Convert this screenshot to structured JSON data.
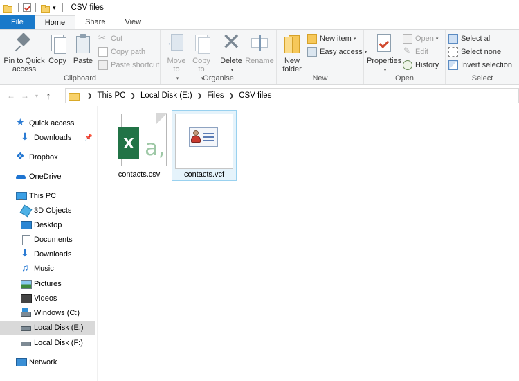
{
  "window": {
    "title": "CSV files"
  },
  "tabs": [
    {
      "label": "File"
    },
    {
      "label": "Home"
    },
    {
      "label": "Share"
    },
    {
      "label": "View"
    }
  ],
  "ribbon": {
    "clipboard": {
      "label": "Clipboard",
      "pin": "Pin to Quick access",
      "copy": "Copy",
      "paste": "Paste",
      "cut": "Cut",
      "copy_path": "Copy path",
      "paste_shortcut": "Paste shortcut"
    },
    "organise": {
      "label": "Organise",
      "move_to": "Move to",
      "copy_to": "Copy to",
      "delete": "Delete",
      "rename": "Rename"
    },
    "new": {
      "label": "New",
      "new_folder": "New folder",
      "new_item": "New item",
      "easy_access": "Easy access"
    },
    "open": {
      "label": "Open",
      "properties": "Properties",
      "open": "Open",
      "edit": "Edit",
      "history": "History"
    },
    "select": {
      "label": "Select",
      "select_all": "Select all",
      "select_none": "Select none",
      "invert": "Invert selection"
    }
  },
  "address": {
    "crumbs": [
      "This PC",
      "Local Disk (E:)",
      "Files",
      "CSV files"
    ]
  },
  "sidebar": {
    "items": [
      {
        "label": "Quick access",
        "icon": "star-icon"
      },
      {
        "label": "Downloads",
        "icon": "download-icon"
      },
      {
        "label": "Dropbox",
        "icon": "dropbox-icon"
      },
      {
        "label": "OneDrive",
        "icon": "cloud-icon"
      },
      {
        "label": "This PC",
        "icon": "computer-icon"
      },
      {
        "label": "3D Objects",
        "icon": "cube-icon"
      },
      {
        "label": "Desktop",
        "icon": "desktop-icon"
      },
      {
        "label": "Documents",
        "icon": "document-icon"
      },
      {
        "label": "Downloads",
        "icon": "download-icon"
      },
      {
        "label": "Music",
        "icon": "music-icon"
      },
      {
        "label": "Pictures",
        "icon": "pictures-icon"
      },
      {
        "label": "Videos",
        "icon": "video-icon"
      },
      {
        "label": "Windows (C:)",
        "icon": "drive-icon"
      },
      {
        "label": "Local Disk (E:)",
        "icon": "drive-icon"
      },
      {
        "label": "Local Disk (F:)",
        "icon": "drive-icon"
      },
      {
        "label": "Network",
        "icon": "network-icon"
      }
    ]
  },
  "files": [
    {
      "name": "contacts.csv",
      "icon": "excel-csv-icon"
    },
    {
      "name": "contacts.vcf",
      "icon": "vcard-icon"
    }
  ]
}
